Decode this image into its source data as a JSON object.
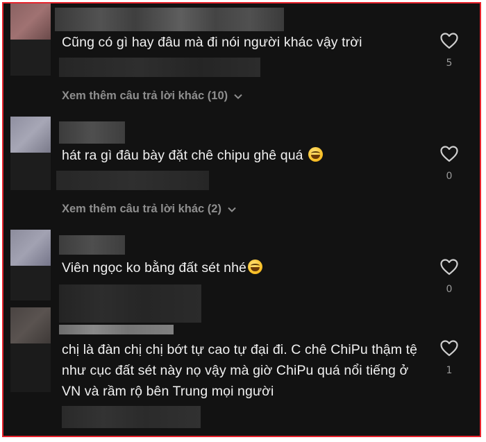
{
  "comments": [
    {
      "text": "Cũng có gì hay đâu mà đi nói người khác vậy trời",
      "likes": "5",
      "emoji": false
    },
    {
      "text": "hát ra gì đâu bày đặt chê chipu ghê quá",
      "likes": "0",
      "emoji": true
    },
    {
      "text": "Viên ngọc ko bằng đất sét nhé",
      "likes": "0",
      "emoji": true
    },
    {
      "text": "chị là đàn chị chị bớt tự cao tự đại đi. C chê ChiPu thậm tệ như cục đất sét này nọ vậy mà giờ ChiPu quá nổi tiếng ở VN và rầm rộ bên Trung mọi người",
      "likes": "1",
      "emoji": false
    }
  ],
  "replies": [
    {
      "label": "Xem thêm câu trả lời khác (10)"
    },
    {
      "label": "Xem thêm câu trả lời khác (2)"
    }
  ],
  "icons": {
    "like": "heart-outline-icon",
    "expand": "chevron-down-icon",
    "laugh": "tears-of-joy-emoji-icon"
  },
  "colors": {
    "background": "#121212",
    "text": "#f1f1f1",
    "muted": "#8e8e8e",
    "frame": "#e8232c"
  }
}
